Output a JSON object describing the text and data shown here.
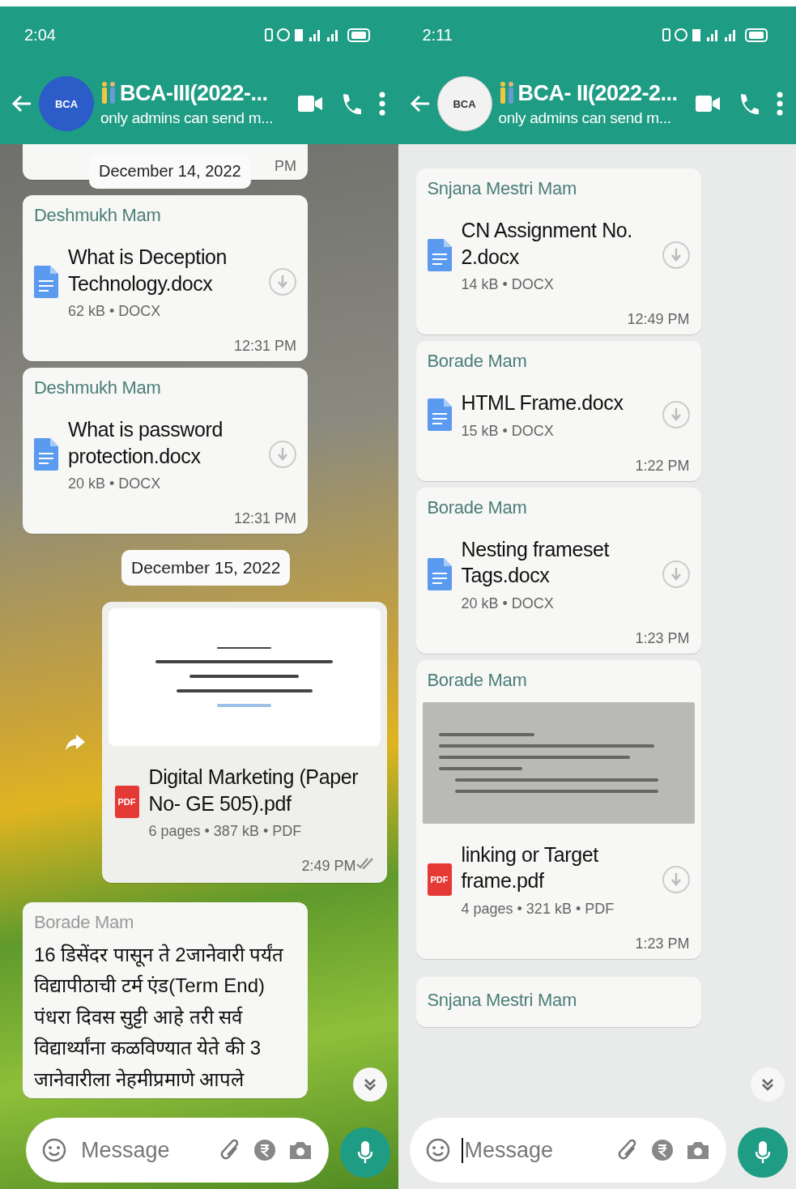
{
  "phones": [
    {
      "kind": "photo",
      "status_bar": {
        "time": "2:04"
      },
      "header": {
        "avatar": {
          "text": "BCA",
          "color": "#2b5cc8"
        },
        "title": "BCA-III(2022-...",
        "subtitle": "only admins can send m..."
      },
      "messages": [
        {
          "kind": "partial",
          "time": "PM"
        },
        {
          "kind": "date",
          "text": "December 14, 2022"
        },
        {
          "kind": "doc",
          "sender": "Deshmukh Mam",
          "name": "What is Deception Technology.docx",
          "meta": "62 kB • DOCX",
          "time": "12:31 PM"
        },
        {
          "kind": "doc",
          "sender": "Deshmukh Mam",
          "name": "What is password protection.docx",
          "meta": "20 kB • DOCX",
          "time": "12:31 PM"
        },
        {
          "kind": "date",
          "text": "December 15, 2022"
        },
        {
          "kind": "outgoing_pdf",
          "icon_label": "PDF",
          "name": "Digital Marketing (Paper No- GE 505).pdf",
          "meta": "6 pages • 387 kB • PDF",
          "time": "2:49 PM",
          "read": false
        },
        {
          "kind": "text",
          "sender": "Borade Mam",
          "text": "16 डिसेंदर पासून ते 2जानेवारी पर्यंत विद्यापीठाची टर्म एंड(Term End) पंधरा दिवस सुट्टी आहे तरी सर्व विद्यार्थ्यांना कळविण्यात येते की 3 जानेवारीला नेहमीप्रमाणे आपले"
        }
      ],
      "composer": {
        "placeholder": "Message",
        "focused": false
      }
    },
    {
      "kind": "plain",
      "status_bar": {
        "time": "2:11"
      },
      "header": {
        "avatar": {
          "text": "BCA",
          "color": "#f2f2f2"
        },
        "title": "BCA- II(2022-2...",
        "subtitle": "only admins can send m..."
      },
      "messages": [
        {
          "kind": "doc",
          "sender": "Snjana Mestri Mam",
          "name": "CN Assignment No. 2.docx",
          "meta": "14 kB • DOCX",
          "time": "12:49 PM"
        },
        {
          "kind": "doc",
          "sender": "Borade Mam",
          "name": "HTML Frame.docx",
          "meta": "15 kB • DOCX",
          "time": "1:22 PM"
        },
        {
          "kind": "doc",
          "sender": "Borade Mam",
          "name": "Nesting frameset Tags.docx",
          "meta": "20 kB • DOCX",
          "time": "1:23 PM"
        },
        {
          "kind": "media_pdf",
          "sender": "Borade Mam",
          "icon_label": "PDF",
          "name": "linking or Target frame.pdf",
          "meta": "4 pages • 321 kB • PDF",
          "time": "1:23 PM"
        },
        {
          "kind": "sender_only",
          "sender": "Snjana Mestri Mam"
        }
      ],
      "composer": {
        "placeholder": "Message",
        "focused": true
      }
    }
  ]
}
